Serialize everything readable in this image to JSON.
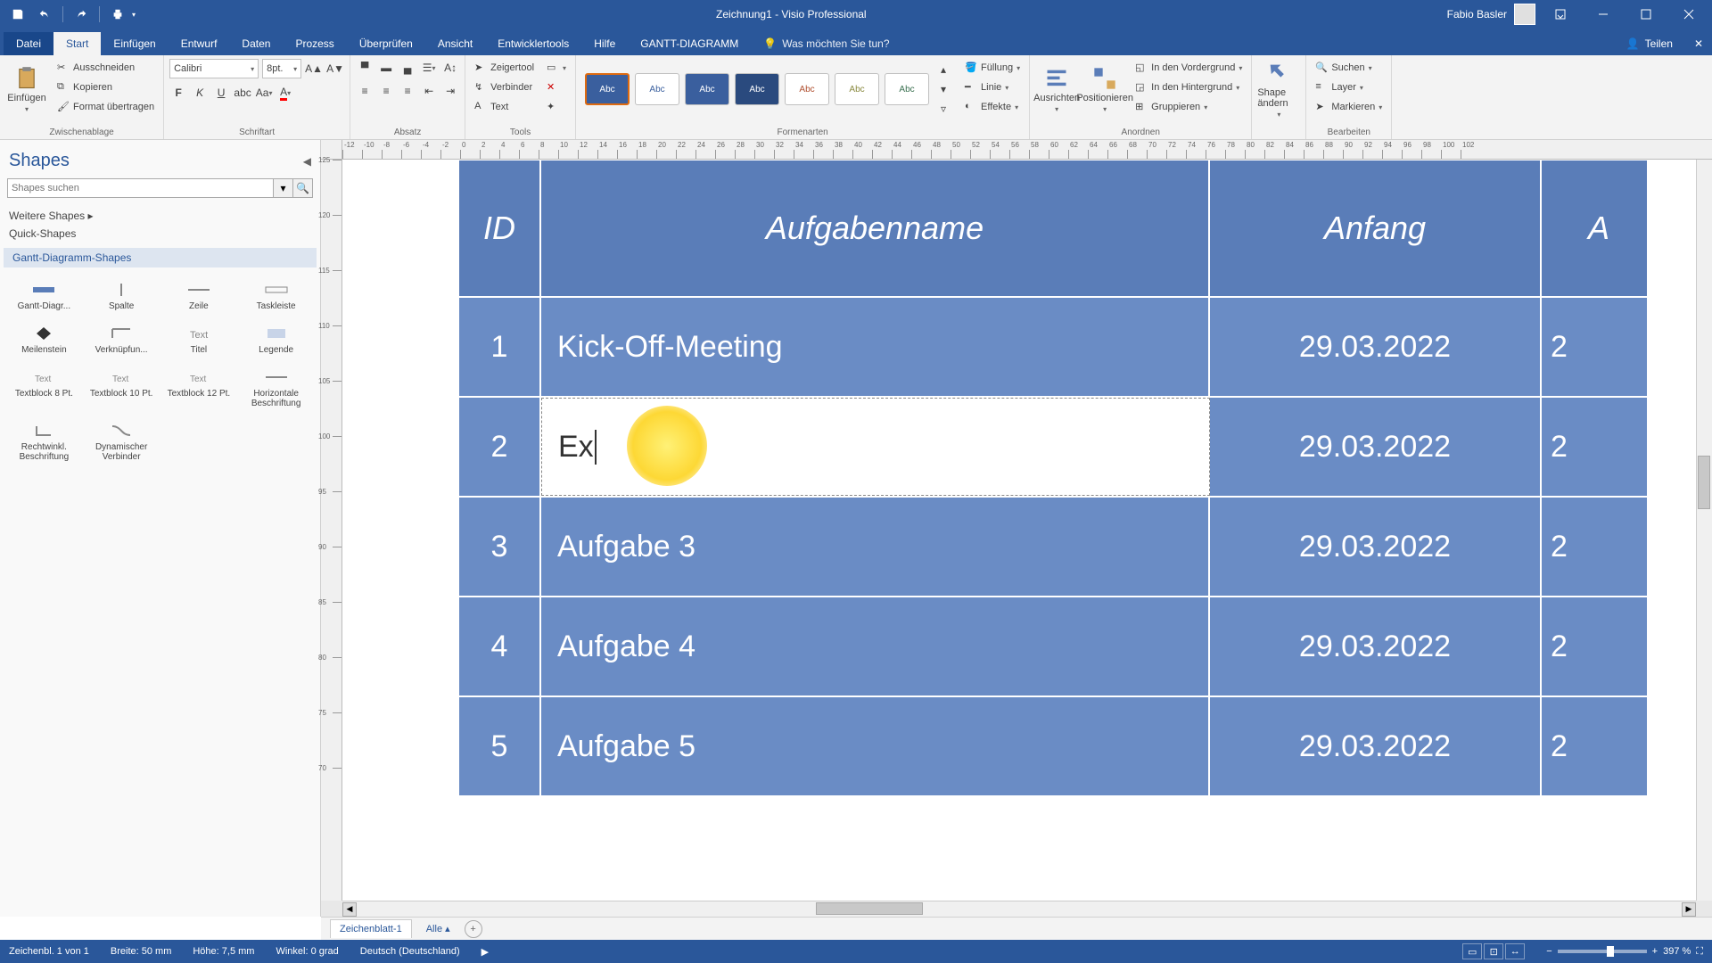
{
  "titlebar": {
    "title": "Zeichnung1 - Visio Professional",
    "user": "Fabio Basler"
  },
  "tabs": {
    "file": "Datei",
    "items": [
      "Start",
      "Einfügen",
      "Entwurf",
      "Daten",
      "Prozess",
      "Überprüfen",
      "Ansicht",
      "Entwicklertools",
      "Hilfe",
      "GANTT-DIAGRAMM"
    ],
    "active": "Start",
    "tell_me": "Was möchten Sie tun?",
    "share": "Teilen"
  },
  "ribbon": {
    "clipboard": {
      "title": "Zwischenablage",
      "paste": "Einfügen",
      "cut": "Ausschneiden",
      "copy": "Kopieren",
      "format": "Format übertragen"
    },
    "font": {
      "title": "Schriftart",
      "name": "Calibri",
      "size": "8pt."
    },
    "paragraph": {
      "title": "Absatz"
    },
    "tools": {
      "title": "Tools",
      "pointer": "Zeigertool",
      "connector": "Verbinder",
      "text": "Text"
    },
    "styles": {
      "title": "Formenarten",
      "label": "Abc",
      "fill": "Füllung",
      "line": "Linie",
      "effects": "Effekte"
    },
    "arrange": {
      "title": "Anordnen",
      "align": "Ausrichten",
      "position": "Positionieren",
      "front": "In den Vordergrund",
      "back": "In den Hintergrund",
      "group": "Gruppieren"
    },
    "shapechange": {
      "title": "",
      "label": "Shape ändern"
    },
    "editing": {
      "title": "Bearbeiten",
      "find": "Suchen",
      "layer": "Layer",
      "select": "Markieren"
    }
  },
  "shapes_panel": {
    "title": "Shapes",
    "search_placeholder": "Shapes suchen",
    "more": "Weitere Shapes",
    "quick": "Quick-Shapes",
    "category": "Gantt-Diagramm-Shapes",
    "items": [
      "Gantt-Diagr...",
      "Spalte",
      "Zeile",
      "Taskleiste",
      "Meilenstein",
      "Verknüpfun...",
      "Titel",
      "Legende",
      "Textblock 8 Pt.",
      "Textblock 10 Pt.",
      "Textblock 12 Pt.",
      "Horizontale Beschriftung",
      "Rechtwinkl. Beschriftung",
      "Dynamischer Verbinder"
    ]
  },
  "gantt": {
    "headers": {
      "id": "ID",
      "name": "Aufgabenname",
      "start": "Anfang",
      "extra": "A"
    },
    "rows": [
      {
        "id": "1",
        "name": "Kick-Off-Meeting",
        "start": "29.03.2022",
        "extra": "2"
      },
      {
        "id": "2",
        "name": "Ex",
        "start": "29.03.2022",
        "extra": "2",
        "editing": true
      },
      {
        "id": "3",
        "name": "Aufgabe 3",
        "start": "29.03.2022",
        "extra": "2"
      },
      {
        "id": "4",
        "name": "Aufgabe 4",
        "start": "29.03.2022",
        "extra": "2"
      },
      {
        "id": "5",
        "name": "Aufgabe 5",
        "start": "29.03.2022",
        "extra": "2"
      }
    ]
  },
  "sheets": {
    "tab": "Zeichenblatt-1",
    "all": "Alle"
  },
  "status": {
    "page": "Zeichenbl. 1 von 1",
    "width": "Breite: 50 mm",
    "height": "Höhe: 7,5 mm",
    "angle": "Winkel: 0 grad",
    "lang": "Deutsch (Deutschland)",
    "zoom": "397 %"
  },
  "ruler_h": [
    "-12",
    "-10",
    "-8",
    "-6",
    "-4",
    "-2",
    "0",
    "2",
    "4",
    "6",
    "8",
    "10",
    "12",
    "14",
    "16",
    "18",
    "20",
    "22",
    "24",
    "26",
    "28",
    "30",
    "32",
    "34",
    "36",
    "38",
    "40",
    "42",
    "44",
    "46",
    "48",
    "50",
    "52",
    "54",
    "56",
    "58",
    "60",
    "62",
    "64",
    "66",
    "68",
    "70",
    "72",
    "74",
    "76",
    "78",
    "80",
    "82",
    "84",
    "86",
    "88",
    "90",
    "92",
    "94",
    "96",
    "98",
    "100",
    "102"
  ],
  "ruler_v": [
    "125",
    "120",
    "115",
    "110",
    "105",
    "100",
    "95",
    "90",
    "85",
    "80",
    "75",
    "70"
  ]
}
